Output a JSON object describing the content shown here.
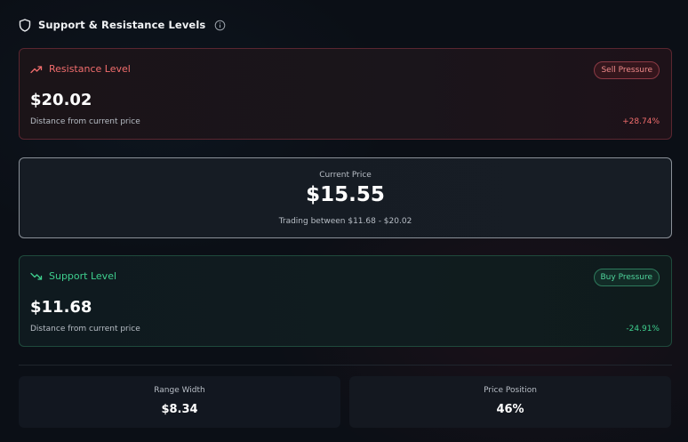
{
  "header": {
    "title": "Support & Resistance Levels",
    "icon": "shield-icon",
    "info_icon": "info-icon"
  },
  "resistance": {
    "label": "Resistance Level",
    "icon": "trending-up-icon",
    "badge": "Sell Pressure",
    "price": "$20.02",
    "distance_label": "Distance from current price",
    "distance_value": "+28.74%",
    "color": "#f26d6d"
  },
  "current": {
    "label": "Current Price",
    "price": "$15.55",
    "range_text": "Trading between $11.68 - $20.02"
  },
  "support": {
    "label": "Support Level",
    "icon": "trending-down-icon",
    "badge": "Buy Pressure",
    "price": "$11.68",
    "distance_label": "Distance from current price",
    "distance_value": "-24.91%",
    "color": "#3ecf8e"
  },
  "stats": {
    "range_width_label": "Range Width",
    "range_width_value": "$8.34",
    "price_position_label": "Price Position",
    "price_position_value": "46%"
  }
}
